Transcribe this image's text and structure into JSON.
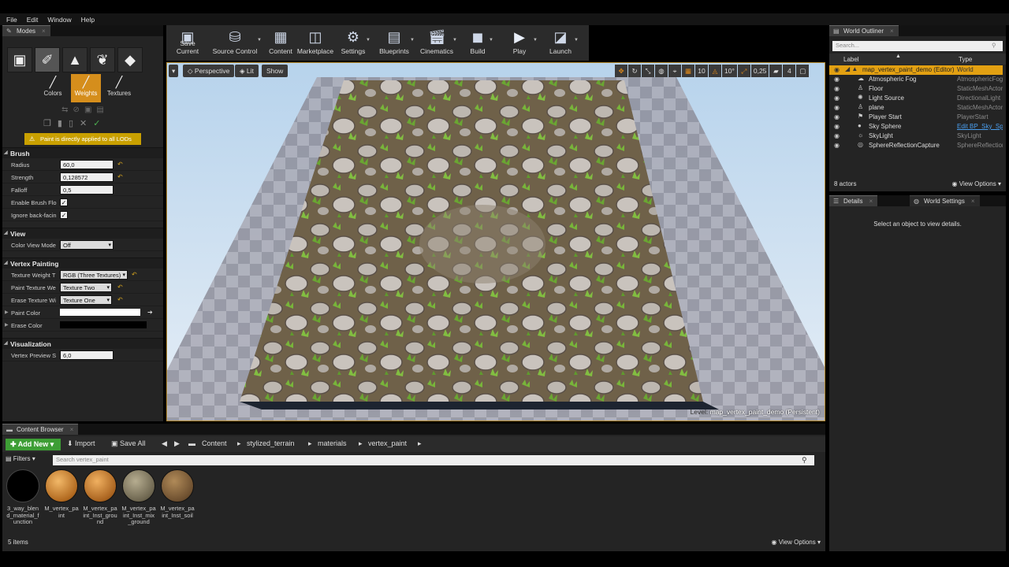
{
  "menu": [
    "File",
    "Edit",
    "Window",
    "Help"
  ],
  "modes": {
    "tab": "Modes",
    "paint_tabs": [
      "Colors",
      "Weights",
      "Textures"
    ],
    "lod_message": "Paint is directly applied to all LODs",
    "brush": {
      "title": "Brush",
      "radius_label": "Radius",
      "radius": "60,0",
      "strength_label": "Strength",
      "strength": "0,128572",
      "falloff_label": "Falloff",
      "falloff": "0,5",
      "enable_flow_label": "Enable Brush Flo",
      "ignore_backface_label": "Ignore back-facin"
    },
    "view": {
      "title": "View",
      "color_view_label": "Color View Mode",
      "color_view": "Off"
    },
    "vertex": {
      "title": "Vertex Painting",
      "weight_type_label": "Texture Weight T",
      "weight_type": "RGB (Three Textures)",
      "paint_weight_label": "Paint Texture We",
      "paint_weight": "Texture Two",
      "erase_weight_label": "Erase Texture Wi",
      "erase_weight": "Texture One",
      "paint_color_label": "Paint Color",
      "erase_color_label": "Erase Color"
    },
    "visualization": {
      "title": "Visualization",
      "preview_label": "Vertex Preview S",
      "preview": "6,0"
    }
  },
  "toolbar": [
    "Save Current",
    "Source Control",
    "Content",
    "Marketplace",
    "Settings",
    "Blueprints",
    "Cinematics",
    "Build",
    "Play",
    "Launch"
  ],
  "viewport": {
    "perspective": "Perspective",
    "lit": "Lit",
    "show": "Show",
    "grid_snap": "10",
    "rot_snap": "10°",
    "scale_snap": "0,25",
    "cam_speed": "4",
    "level_prefix": "Level:",
    "level_name": "map_vertex_paint_demo (Persistent)"
  },
  "outliner": {
    "tab": "World Outliner",
    "search_placeholder": "Search...",
    "col_label": "Label",
    "col_type": "Type",
    "rows": [
      {
        "label": "map_vertex_paint_demo (Editor)",
        "type": "World"
      },
      {
        "label": "Atmospheric Fog",
        "type": "AtmosphericFog"
      },
      {
        "label": "Floor",
        "type": "StaticMeshActor"
      },
      {
        "label": "Light Source",
        "type": "DirectionalLight"
      },
      {
        "label": "plane",
        "type": "StaticMeshActor"
      },
      {
        "label": "Player Start",
        "type": "PlayerStart"
      },
      {
        "label": "Sky Sphere",
        "type": "Edit BP_Sky_Sp"
      },
      {
        "label": "SkyLight",
        "type": "SkyLight"
      },
      {
        "label": "SphereReflectionCapture",
        "type": "SphereReflection"
      }
    ],
    "count": "8 actors",
    "view_options": "View Options"
  },
  "details": {
    "tab": "Details",
    "tab2": "World Settings",
    "message": "Select an object to view details."
  },
  "content_browser": {
    "tab": "Content Browser",
    "add_new": "Add New",
    "import": "Import",
    "save_all": "Save All",
    "path": [
      "Content",
      "stylized_terrain",
      "materials",
      "vertex_paint"
    ],
    "filters": "Filters",
    "search_placeholder": "Search vertex_paint",
    "assets": [
      "3_way_blend_material_function",
      "M_vertex_paint",
      "M_vertex_paint_Inst_ground",
      "M_vertex_paint_Inst_mix_ground",
      "M_vertex_paint_Inst_soil"
    ],
    "count": "5 items",
    "view_options": "View Options"
  },
  "colors": {
    "accent": "#d58e1c",
    "selection": "#e2a012",
    "add_new": "#3d9e35"
  }
}
